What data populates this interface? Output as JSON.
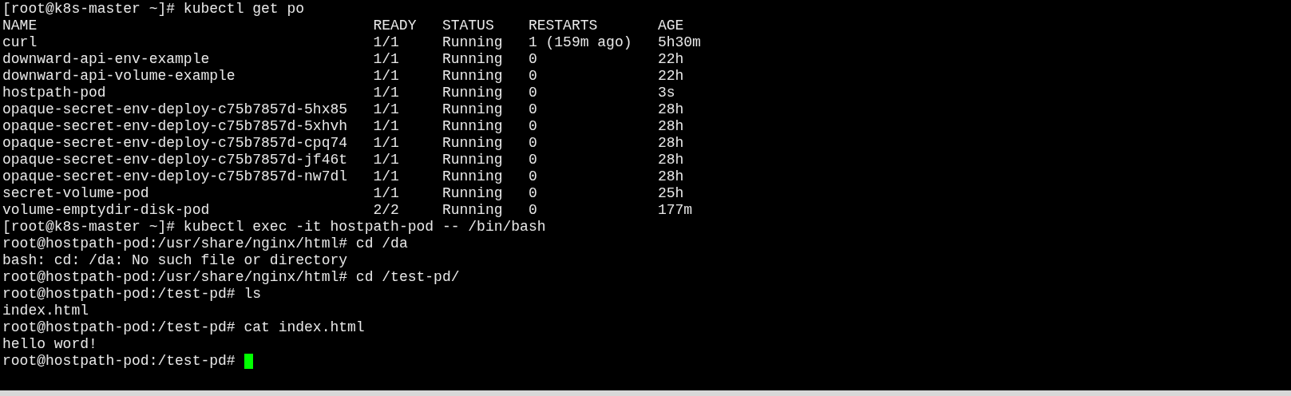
{
  "terminal": {
    "blocks": [
      {
        "kind": "line",
        "text": "[root@k8s-master ~]# kubectl get po",
        "cursor": false
      },
      {
        "kind": "table",
        "columns": [
          "NAME",
          "READY",
          "STATUS",
          "RESTARTS",
          "AGE"
        ],
        "rows": [
          [
            "curl",
            "1/1",
            "Running",
            "1 (159m ago)",
            "5h30m"
          ],
          [
            "downward-api-env-example",
            "1/1",
            "Running",
            "0",
            "22h"
          ],
          [
            "downward-api-volume-example",
            "1/1",
            "Running",
            "0",
            "22h"
          ],
          [
            "hostpath-pod",
            "1/1",
            "Running",
            "0",
            "3s"
          ],
          [
            "opaque-secret-env-deploy-c75b7857d-5hx85",
            "1/1",
            "Running",
            "0",
            "28h"
          ],
          [
            "opaque-secret-env-deploy-c75b7857d-5xhvh",
            "1/1",
            "Running",
            "0",
            "28h"
          ],
          [
            "opaque-secret-env-deploy-c75b7857d-cpq74",
            "1/1",
            "Running",
            "0",
            "28h"
          ],
          [
            "opaque-secret-env-deploy-c75b7857d-jf46t",
            "1/1",
            "Running",
            "0",
            "28h"
          ],
          [
            "opaque-secret-env-deploy-c75b7857d-nw7dl",
            "1/1",
            "Running",
            "0",
            "28h"
          ],
          [
            "secret-volume-pod",
            "1/1",
            "Running",
            "0",
            "25h"
          ],
          [
            "volume-emptydir-disk-pod",
            "2/2",
            "Running",
            "0",
            "177m"
          ]
        ]
      },
      {
        "kind": "line",
        "text": "[root@k8s-master ~]# kubectl exec -it hostpath-pod -- /bin/bash",
        "cursor": false
      },
      {
        "kind": "line",
        "text": "root@hostpath-pod:/usr/share/nginx/html# cd /da",
        "cursor": false
      },
      {
        "kind": "line",
        "text": "bash: cd: /da: No such file or directory",
        "cursor": false
      },
      {
        "kind": "line",
        "text": "root@hostpath-pod:/usr/share/nginx/html# cd /test-pd/",
        "cursor": false
      },
      {
        "kind": "line",
        "text": "root@hostpath-pod:/test-pd# ls",
        "cursor": false
      },
      {
        "kind": "line",
        "text": "index.html",
        "cursor": false
      },
      {
        "kind": "line",
        "text": "root@hostpath-pod:/test-pd# cat index.html",
        "cursor": false
      },
      {
        "kind": "line",
        "text": "hello word!",
        "cursor": false
      },
      {
        "kind": "line",
        "text": "root@hostpath-pod:/test-pd#",
        "cursor": true
      }
    ]
  }
}
